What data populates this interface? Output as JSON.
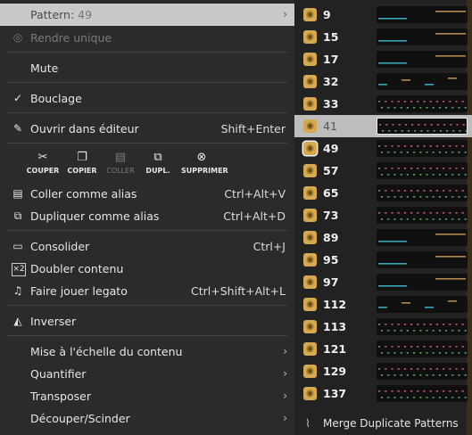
{
  "menu": {
    "pattern": {
      "label": "Pattern:",
      "value": "49"
    },
    "rendre_unique": "Rendre unique",
    "mute": "Mute",
    "bouclage": "Bouclage",
    "ouvrir": {
      "label": "Ouvrir dans éditeur",
      "shortcut": "Shift+Enter"
    },
    "tools": [
      {
        "label": "COUPER",
        "glyph": "✂",
        "enabled": true
      },
      {
        "label": "COPIER",
        "glyph": "❐",
        "enabled": true
      },
      {
        "label": "COLLER",
        "glyph": "▤",
        "enabled": false
      },
      {
        "label": "DUPL.",
        "glyph": "⧉",
        "enabled": true
      },
      {
        "label": "SUPPRIMER",
        "glyph": "⊗",
        "enabled": true
      }
    ],
    "coller_alias": {
      "label": "Coller comme alias",
      "shortcut": "Ctrl+Alt+V"
    },
    "dupliquer_alias": {
      "label": "Dupliquer comme alias",
      "shortcut": "Ctrl+Alt+D"
    },
    "consolider": {
      "label": "Consolider",
      "shortcut": "Ctrl+J"
    },
    "doubler": "Doubler contenu",
    "legato": {
      "label": "Faire jouer legato",
      "shortcut": "Ctrl+Shift+Alt+L"
    },
    "inverser": "Inverser",
    "mise_echelle": "Mise à l'échelle du contenu",
    "quantifier": "Quantifier",
    "transposer": "Transposer",
    "decouper": "Découper/Scinder"
  },
  "patterns": [
    {
      "number": "9",
      "style": "sparse"
    },
    {
      "number": "15",
      "style": "sparse"
    },
    {
      "number": "17",
      "style": "sparse"
    },
    {
      "number": "32",
      "style": "mixed"
    },
    {
      "number": "33",
      "style": "dense"
    },
    {
      "number": "41",
      "style": "dense",
      "selected": true
    },
    {
      "number": "49",
      "style": "dense",
      "current": true
    },
    {
      "number": "57",
      "style": "dense"
    },
    {
      "number": "65",
      "style": "dense"
    },
    {
      "number": "73",
      "style": "dense"
    },
    {
      "number": "89",
      "style": "sparse"
    },
    {
      "number": "95",
      "style": "sparse"
    },
    {
      "number": "97",
      "style": "sparse"
    },
    {
      "number": "112",
      "style": "mixed"
    },
    {
      "number": "113",
      "style": "dense"
    },
    {
      "number": "121",
      "style": "dense"
    },
    {
      "number": "129",
      "style": "dense"
    },
    {
      "number": "137",
      "style": "dense"
    }
  ],
  "merge": "Merge Duplicate Patterns",
  "colors": {
    "badge": "#d6a84f",
    "note_teal": "#3aa6b8",
    "note_tan": "#b4884c",
    "note_pink": "#c06070",
    "note_green": "#5aa060"
  }
}
